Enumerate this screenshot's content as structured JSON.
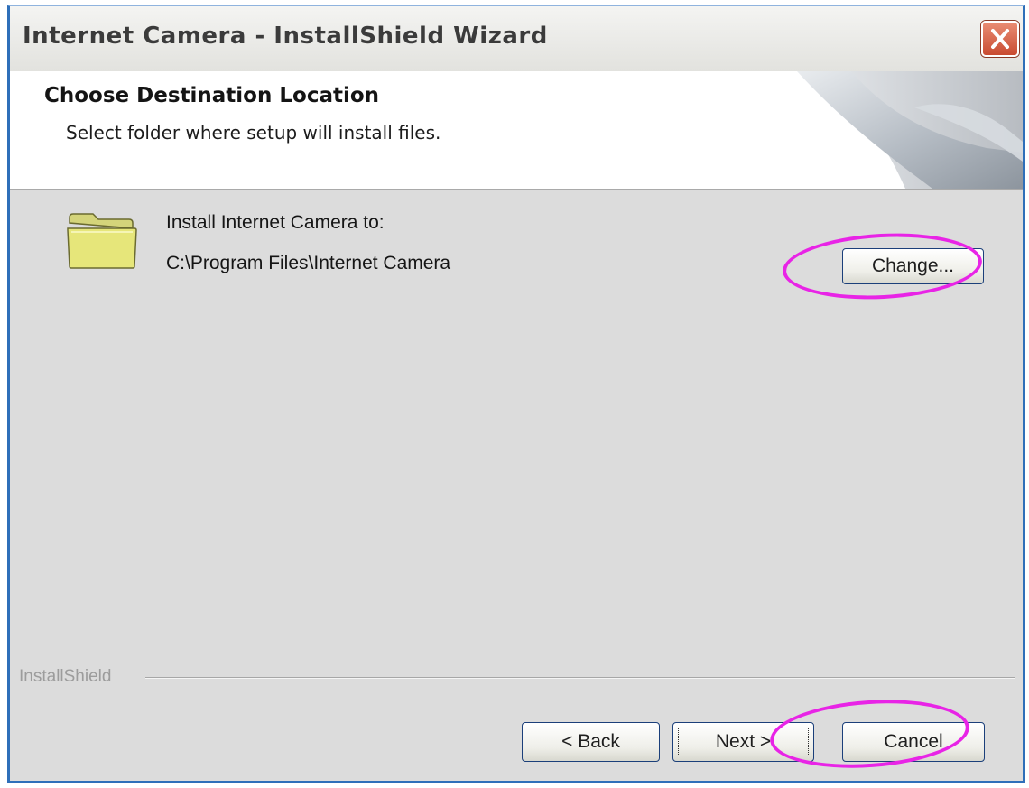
{
  "window": {
    "title": "Internet Camera - InstallShield Wizard",
    "close_icon": "close-x-icon"
  },
  "header": {
    "title": "Choose Destination Location",
    "subtitle": "Select folder where setup will install files.",
    "graphic_icon": "page-curl-graphic"
  },
  "destination": {
    "folder_icon": "folder-icon",
    "label": "Install Internet Camera to:",
    "path": "C:\\Program Files\\Internet Camera",
    "change_label": "Change..."
  },
  "footer": {
    "brand": "InstallShield",
    "back_label": "< Back",
    "next_label": "Next >",
    "cancel_label": "Cancel"
  },
  "colors": {
    "highlight": "#e824e6",
    "close_button": "#d35a3f",
    "folder": "#e6e67a"
  }
}
